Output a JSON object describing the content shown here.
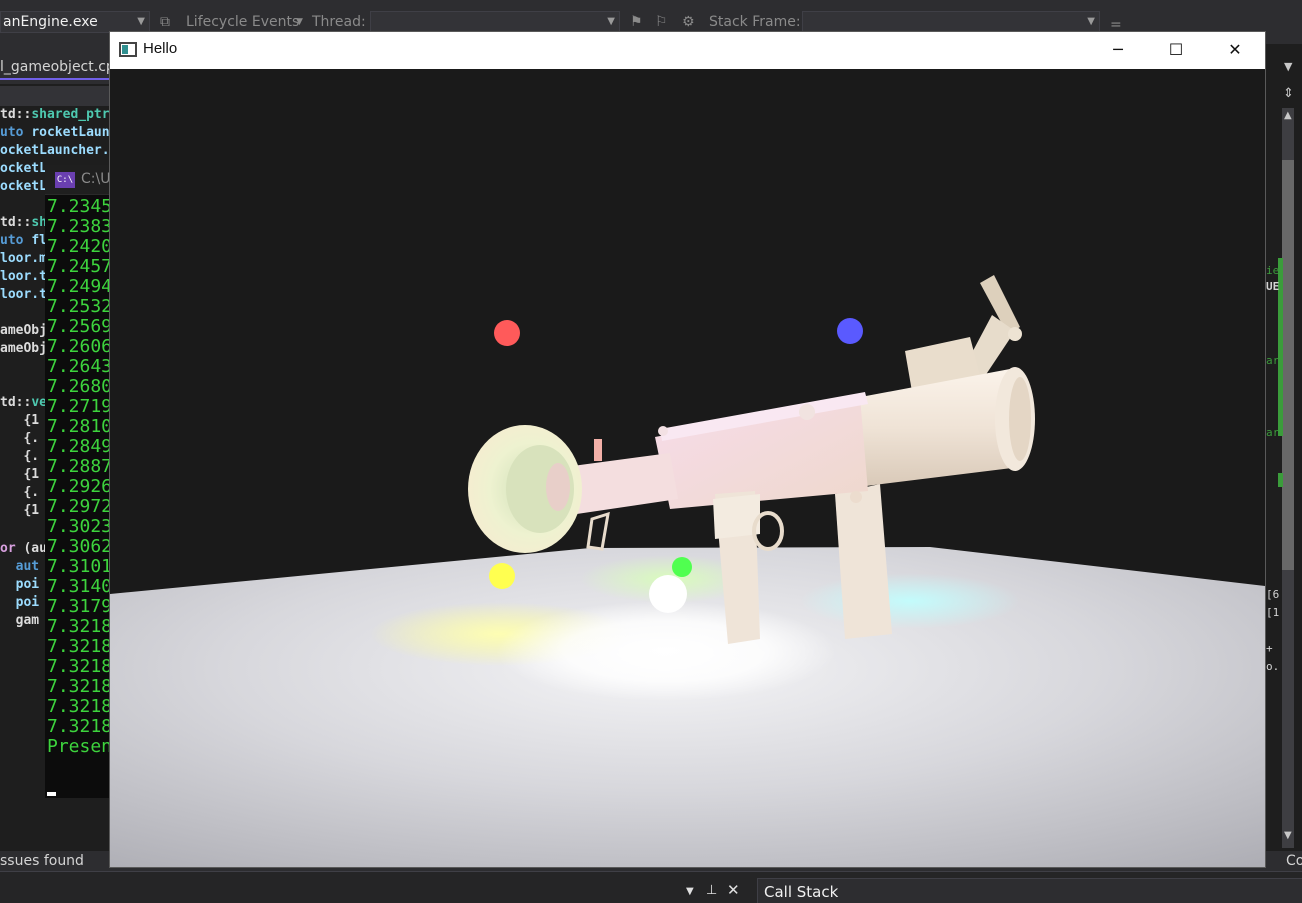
{
  "toolbar": {
    "process_combo": "anEngine.exe",
    "lifecycle_events": "Lifecycle Events",
    "thread_label": "Thread:",
    "thread_value": "",
    "stack_frame_label": "Stack Frame:",
    "stack_frame_value": ""
  },
  "editor": {
    "tab_label": "l_gameobject.cpp",
    "lines": {
      "l1a": "td::",
      "l1b": "shared_ptr",
      "l2a": "uto ",
      "l2b": "rocketLaun",
      "l3a": "ocketLauncher.",
      "l4a": "ocketL",
      "l5a": "ocketL",
      "l6a": "td::",
      "l6b": "sha",
      "l7a": "uto ",
      "l7b": "flo",
      "l8a": "loor.m",
      "l9a": "loor.t",
      "l10a": "loor.t",
      "l11a": "ameObj",
      "l12a": "ameObj",
      "l13a": "td::",
      "l13b": "vec",
      "l14a": "   {1",
      "l15a": "   {.",
      "l16a": "   {.",
      "l17a": "   {1",
      "l18a": "   {.",
      "l19a": "   {1",
      "l20a": "or ",
      "l20b": "(aut",
      "l21a": "  aut",
      "l22a": "  poi",
      "l23a": "  poi",
      "l24a": "  gam"
    }
  },
  "console": {
    "title": "C:\\U",
    "icon_text": "C:\\",
    "lines": [
      "7.2345",
      "7.2383",
      "7.2420",
      "7.2457",
      "7.2494",
      "7.2532",
      "7.2569",
      "7.2606",
      "7.2643",
      "7.2680",
      "7.2719",
      "7.2810",
      "7.2849",
      "7.2887",
      "7.2926",
      "7.2972",
      "7.3023",
      "7.3062",
      "7.3101",
      "7.3140",
      "7.3179",
      "7.3218",
      "7.3218",
      "7.3218",
      "7.3218",
      "7.3218",
      "7.3218"
    ],
    "present": "Presen"
  },
  "right_panel": {
    "text1": "ie",
    "text2": "UE",
    "text3": "ar",
    "text4": "ar",
    "text5": "[6",
    "text6": "[1",
    "text7": "+",
    "text8": "o.",
    "corner": "Co"
  },
  "status": {
    "issues": "ssues found"
  },
  "bottom_pane": {
    "call_stack": "Call Stack"
  },
  "hello_window": {
    "title": "Hello",
    "minimize_icon": "minimize-icon",
    "maximize_icon": "maximize-icon",
    "close_icon": "close-icon"
  },
  "scene": {
    "background": "#1a1a1a",
    "floor_color": "#c9c9cf",
    "lights": {
      "red": "#ff5a5a",
      "blue": "#5a5aff",
      "yellow": "#ffff50",
      "green": "#50ff50",
      "white": "#ffffff"
    },
    "model_color": "#f3e8dc"
  },
  "colors": {
    "accent": "#7160e8",
    "console_text": "#3dd43d",
    "diagnostic_green": "#3b9c3b"
  }
}
